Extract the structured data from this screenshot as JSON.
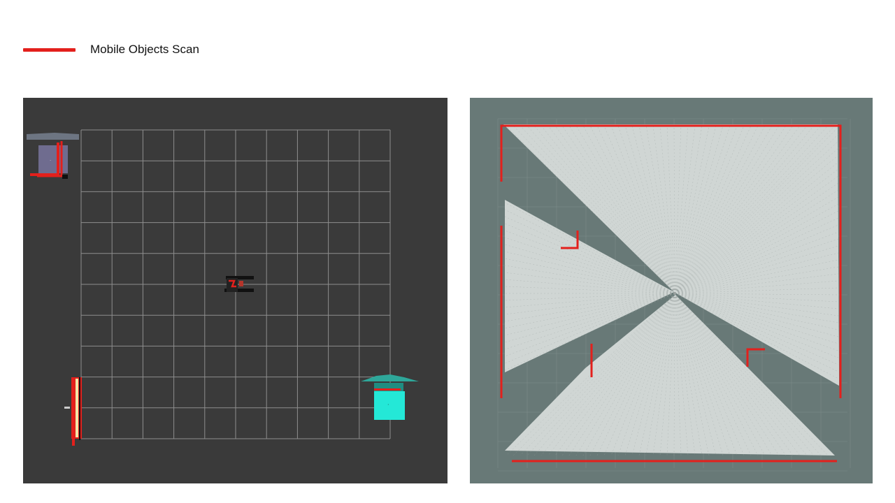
{
  "legend": {
    "label": "Mobile Objects Scan",
    "color": "#e3201c"
  },
  "colors": {
    "sim_background": "#3a3a3a",
    "grid_line": "#8e8e8e",
    "map_background": "#687977",
    "scan_fill": "#d0d6d4",
    "scan_ray": "#9aa2a0",
    "scan_red": "#e3201c",
    "purple_box": "#6f6c8f",
    "purple_roof": "#6d7582",
    "cyan_box": "#24e8d7",
    "cyan_roof": "#2ea79a",
    "yellow_strip": "#f3e6a8"
  },
  "icons": {
    "robot": "robot-marker-icon",
    "purple_box": "box-obstacle-icon",
    "cyan_box": "box-obstacle-icon",
    "wall": "wall-obstacle-icon"
  }
}
